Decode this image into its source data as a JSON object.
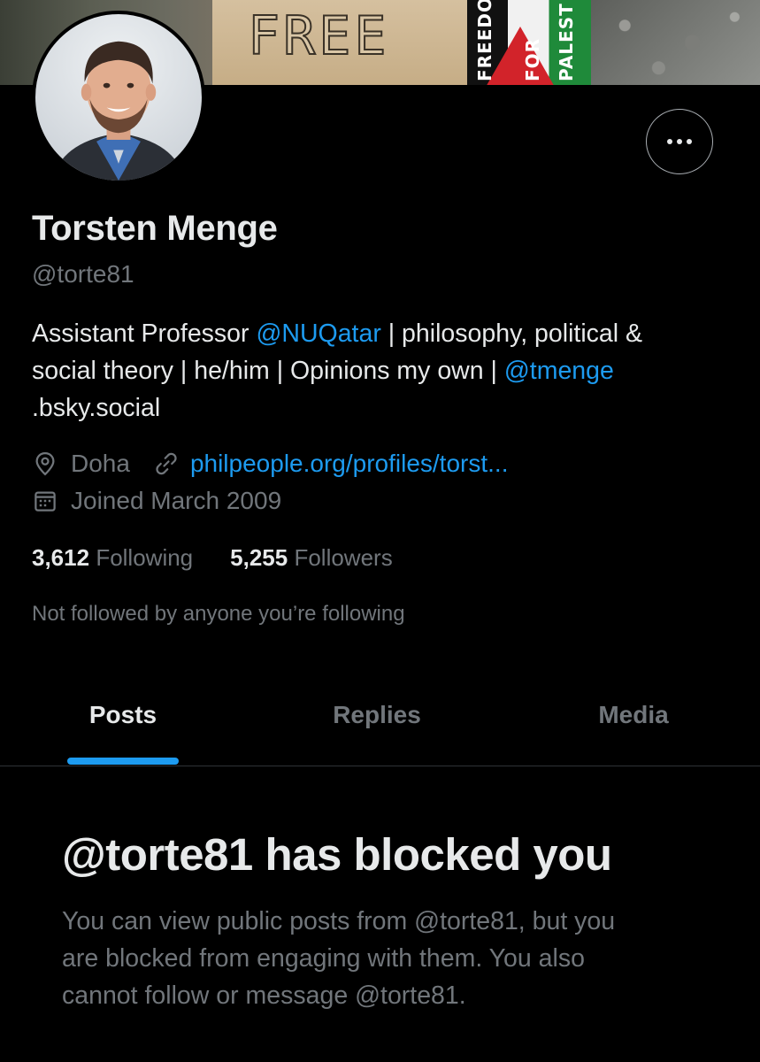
{
  "banner": {
    "sign_text": "FREE",
    "flag_lines": [
      "FREEDO",
      "FOR",
      "PALEST"
    ]
  },
  "profile": {
    "avatar_icon": "profile-photo",
    "more_icon": "more-horizontal-icon",
    "name": "Torsten Menge",
    "handle": "@torte81",
    "bio": {
      "line1_pre": "Assistant Professor ",
      "line1_mention": "@NUQatar",
      "line1_post": " | philosophy, political &",
      "line2_pre": "social theory | he/him | Opinions my own | ",
      "line2_mention": "@tmenge",
      "line3": ".bsky.social"
    },
    "location": "Doha",
    "website": "philpeople.org/profiles/torst...",
    "joined": "Joined March 2009",
    "following_count": "3,612",
    "following_label": "Following",
    "followers_count": "5,255",
    "followers_label": "Followers",
    "followed_by": "Not followed by anyone you’re following"
  },
  "tabs": [
    {
      "label": "Posts",
      "active": true
    },
    {
      "label": "Replies",
      "active": false
    },
    {
      "label": "Media",
      "active": false
    }
  ],
  "blocked": {
    "title": "@torte81 has blocked you",
    "line1": "You can view public posts from @torte81, but you",
    "line2": "are blocked from engaging with them. You also",
    "line3": "cannot follow or message @torte81."
  },
  "colors": {
    "background": "#000000",
    "text_primary": "#e7e9ea",
    "text_secondary": "#71767b",
    "accent": "#1d9bf0",
    "border": "#2f3336"
  }
}
